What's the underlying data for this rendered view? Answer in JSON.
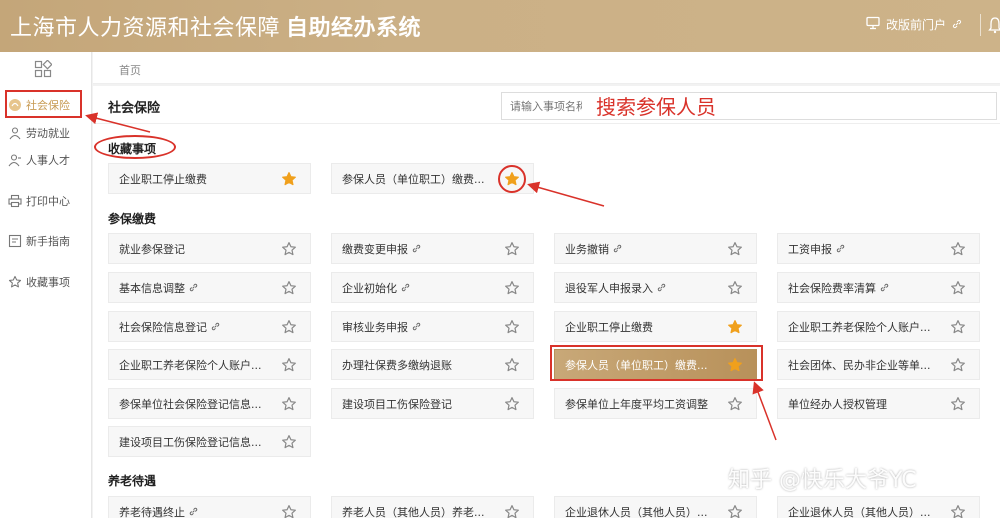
{
  "header": {
    "title": "上海市人力资源和社会保障",
    "subtitle": "自助经办系统",
    "portal_label": "改版前门户"
  },
  "sidebar": {
    "items": [
      {
        "label": "社会保险",
        "icon": "social-insurance-icon",
        "active": true
      },
      {
        "label": "劳动就业",
        "icon": "employment-icon"
      },
      {
        "label": "人事人才",
        "icon": "personnel-icon"
      },
      {
        "label": "打印中心",
        "icon": "printer-icon"
      },
      {
        "label": "新手指南",
        "icon": "guide-icon"
      },
      {
        "label": "收藏事项",
        "icon": "star-outline-icon"
      }
    ]
  },
  "breadcrumb": "首页",
  "main": {
    "title": "社会保险",
    "search_placeholder": "请输入事项名称",
    "search_annotation": "搜索参保人员"
  },
  "sections": [
    {
      "title": "收藏事项",
      "items": [
        {
          "label": "企业职工停止缴费",
          "starred": true
        },
        {
          "label": "参保人员（单位职工）缴费...",
          "starred": true
        }
      ]
    },
    {
      "title": "参保缴费",
      "items": [
        {
          "label": "就业参保登记",
          "starred": false
        },
        {
          "label": "缴费变更申报",
          "link": true,
          "starred": false
        },
        {
          "label": "业务撤销",
          "link": true,
          "starred": false
        },
        {
          "label": "工资申报",
          "link": true,
          "starred": false
        },
        {
          "label": "基本信息调整",
          "link": true,
          "starred": false
        },
        {
          "label": "企业初始化",
          "link": true,
          "starred": false
        },
        {
          "label": "退役军人申报录入",
          "link": true,
          "starred": false
        },
        {
          "label": "社会保险费率清算",
          "link": true,
          "starred": false
        },
        {
          "label": "社会保险信息登记",
          "link": true,
          "starred": false
        },
        {
          "label": "审核业务申报",
          "link": true,
          "starred": false
        },
        {
          "label": "企业职工停止缴费",
          "starred": true
        },
        {
          "label": "企业职工养老保险个人账户...",
          "starred": false
        },
        {
          "label": "企业职工养老保险个人账户...",
          "starred": false
        },
        {
          "label": "办理社保费多缴纳退账",
          "starred": false
        },
        {
          "label": "参保人员（单位职工）缴费...",
          "starred": true,
          "highlight": true
        },
        {
          "label": "社会团体、民办非企业等单...",
          "starred": false
        },
        {
          "label": "参保单位社会保险登记信息...",
          "starred": false
        },
        {
          "label": "建设项目工伤保险登记",
          "starred": false
        },
        {
          "label": "参保单位上年度平均工资调整",
          "starred": false
        },
        {
          "label": "单位经办人授权管理",
          "starred": false
        },
        {
          "label": "建设项目工伤保险登记信息...",
          "starred": false
        }
      ]
    },
    {
      "title": "养老待遇",
      "items": [
        {
          "label": "养老待遇终止",
          "link": true,
          "starred": false
        },
        {
          "label": "养老人员（其他人员）养老...",
          "starred": false
        },
        {
          "label": "企业退休人员（其他人员）...",
          "starred": false
        },
        {
          "label": "企业退休人员（其他人员）...",
          "starred": false
        }
      ]
    }
  ],
  "watermark": "知乎 @快乐大爷YC",
  "colors": {
    "header_bg": "#c4a679",
    "accent": "#c79a52",
    "star_filled": "#f0a01c",
    "annotation_red": "#d9322a"
  }
}
